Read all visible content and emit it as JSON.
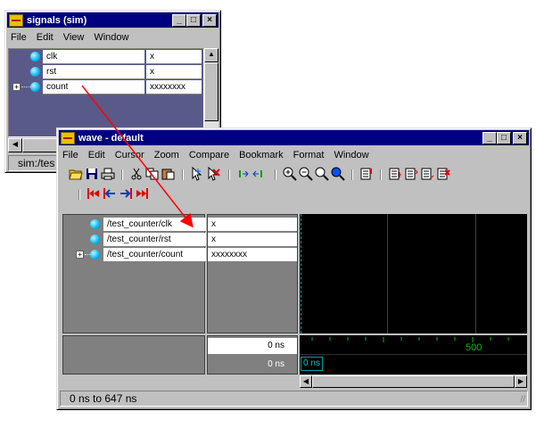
{
  "signals_window": {
    "title": "signals (sim)",
    "menu": [
      "File",
      "Edit",
      "View",
      "Window"
    ],
    "rows": [
      {
        "name": "clk",
        "value": "x",
        "expandable": false
      },
      {
        "name": "rst",
        "value": "x",
        "expandable": false
      },
      {
        "name": "count",
        "value": "xxxxxxxx",
        "expandable": true
      }
    ],
    "status": "sim:/tes"
  },
  "wave_window": {
    "title": "wave - default",
    "menu": [
      "File",
      "Edit",
      "Cursor",
      "Zoom",
      "Compare",
      "Bookmark",
      "Format",
      "Window"
    ],
    "rows": [
      {
        "name": "/test_counter/clk",
        "value": "x",
        "expandable": false
      },
      {
        "name": "/test_counter/rst",
        "value": "x",
        "expandable": false
      },
      {
        "name": "/test_counter/count",
        "value": "xxxxxxxx",
        "expandable": true
      }
    ],
    "now_label": "0 ns",
    "cursor_label": "0 ns",
    "cursor_marker": "0 ns",
    "timeline_tick_label": "500",
    "status": "0 ns to 647 ns"
  },
  "colors": {
    "titlebar": "#000080",
    "wave_background": "#000000",
    "timeline_text": "#00c000",
    "arrow": "#ff0000",
    "cursor": "#00a0a0"
  },
  "toolbar_icons": [
    "open-folder-icon",
    "save-icon",
    "print-icon",
    "cut-icon",
    "copy-icon",
    "paste-icon",
    "select-pointer-icon",
    "delete-cursor-icon",
    "zoom-range-icon",
    "zoom-in-icon",
    "zoom-out-icon",
    "zoom-full-icon",
    "zoom-fit-icon",
    "find-icon",
    "insert-signal-icon",
    "insert-break-icon",
    "insert-divider-icon",
    "delete-signal-icon",
    "first-edge-icon",
    "prev-edge-icon",
    "next-edge-icon",
    "last-edge-icon"
  ]
}
